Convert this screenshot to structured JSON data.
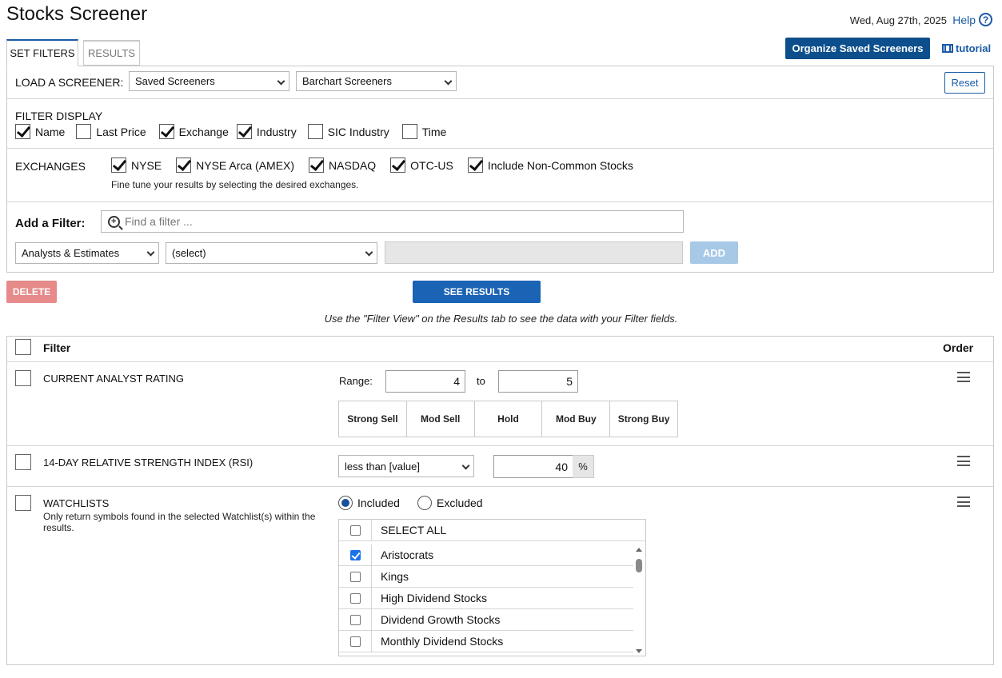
{
  "header": {
    "title": "Stocks Screener",
    "date": "Wed, Aug 27th, 2025",
    "help_label": "Help",
    "help_glyph": "?"
  },
  "tabs": [
    {
      "label": "SET FILTERS",
      "active": true
    },
    {
      "label": "RESULTS",
      "active": false
    }
  ],
  "toolbar": {
    "organize_label": "Organize Saved Screeners",
    "tutorial_label": "tutorial"
  },
  "load": {
    "label": "LOAD A SCREENER:",
    "saved_value": "Saved Screeners",
    "barchart_value": "Barchart Screeners",
    "reset_label": "Reset"
  },
  "filter_display": {
    "label": "FILTER DISPLAY",
    "options": [
      {
        "label": "Name",
        "checked": true
      },
      {
        "label": "Last Price",
        "checked": false
      },
      {
        "label": "Exchange",
        "checked": true
      },
      {
        "label": "Industry",
        "checked": true
      },
      {
        "label": "SIC Industry",
        "checked": false
      },
      {
        "label": "Time",
        "checked": false
      }
    ]
  },
  "exchanges": {
    "label": "EXCHANGES",
    "options": [
      {
        "label": "NYSE",
        "checked": true
      },
      {
        "label": "NYSE Arca (AMEX)",
        "checked": true
      },
      {
        "label": "NASDAQ",
        "checked": true
      },
      {
        "label": "OTC-US",
        "checked": true
      },
      {
        "label": "Include Non-Common Stocks",
        "checked": true
      }
    ],
    "hint": "Fine tune your results by selecting the desired exchanges."
  },
  "add_filter": {
    "label": "Add a Filter:",
    "search_placeholder": "Find a filter ...",
    "category_value": "Analysts & Estimates",
    "field_value": "(select)",
    "add_label": "ADD"
  },
  "actions": {
    "delete_label": "DELETE",
    "see_results_label": "SEE RESULTS",
    "note": "Use the \"Filter View\" on the Results tab to see the data with your Filter fields."
  },
  "table": {
    "filter_header": "Filter",
    "order_header": "Order",
    "rows": {
      "rating": {
        "title": "CURRENT ANALYST RATING",
        "range_label": "Range:",
        "from": "4",
        "to_label": "to",
        "to": "5",
        "scale": [
          "Strong Sell",
          "Mod Sell",
          "Hold",
          "Mod Buy",
          "Strong Buy"
        ]
      },
      "rsi": {
        "title": "14-DAY RELATIVE STRENGTH INDEX (RSI)",
        "operator": "less than [value]",
        "value": "40",
        "unit": "%"
      },
      "watchlists": {
        "title": "WATCHLISTS",
        "description": "Only return symbols found in the selected Watchlist(s) within the results.",
        "included_label": "Included",
        "excluded_label": "Excluded",
        "mode": "Included",
        "select_all_label": "SELECT ALL",
        "items": [
          {
            "label": "Aristocrats",
            "checked": true
          },
          {
            "label": "Kings",
            "checked": false
          },
          {
            "label": "High Dividend Stocks",
            "checked": false
          },
          {
            "label": "Dividend Growth Stocks",
            "checked": false
          },
          {
            "label": "Monthly Dividend Stocks",
            "checked": false
          }
        ]
      }
    }
  }
}
